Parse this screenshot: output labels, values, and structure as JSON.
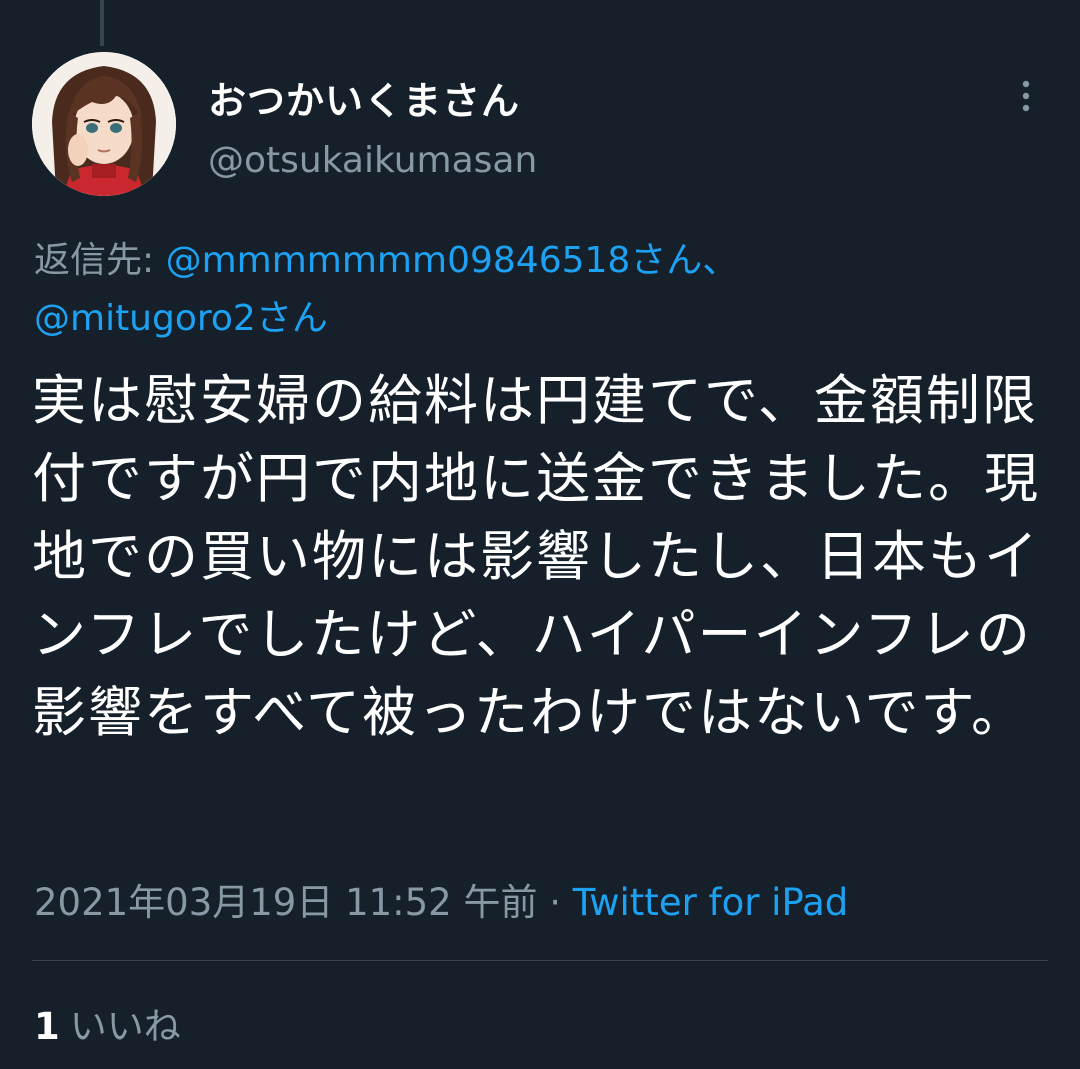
{
  "tweet": {
    "author": {
      "display_name": "おつかいくまさん",
      "handle": "@otsukaikumasan"
    },
    "reply_to": {
      "prefix": "返信先:",
      "mention_1": "@mmmmmmm09846518さん、",
      "mention_2": "@mitugoro2さん"
    },
    "text": "実は慰安婦の給料は円建てで、金額制限付ですが円で内地に送金できました。現地での買い物には影響したし、日本もインフレでしたけど、ハイパーインフレの影響をすべて被ったわけではないです。",
    "timestamp": "2021年03月19日 11:52 午前",
    "separator": "·",
    "source": "Twitter for iPad",
    "likes": {
      "count": "1",
      "label": "いいね"
    }
  },
  "icons": {
    "more": "more-vertical-icon",
    "avatar": "avatar-image"
  },
  "colors": {
    "background": "#15202b",
    "text": "#ffffff",
    "secondary": "#8899a6",
    "accent": "#1da1f2",
    "divider": "#38444d"
  }
}
